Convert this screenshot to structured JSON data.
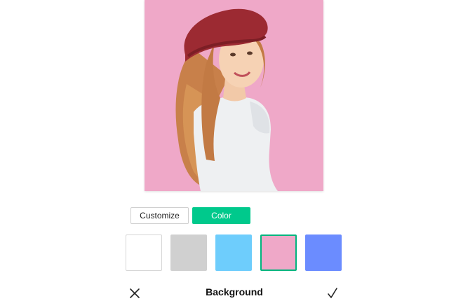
{
  "preview": {
    "background_color": "#efa8c8",
    "subject": "woman-in-red-beret-photo"
  },
  "mode_toggle": {
    "customize_label": "Customize",
    "color_label": "Color",
    "active": "Color",
    "accent_color": "#00c98c"
  },
  "swatches": [
    {
      "color": "#ffffff",
      "selected": false
    },
    {
      "color": "#d0d0d0",
      "selected": false
    },
    {
      "color": "#6ecdfc",
      "selected": false
    },
    {
      "color": "#efa8c8",
      "selected": true
    },
    {
      "color": "#6b8cff",
      "selected": false
    }
  ],
  "bottom_bar": {
    "title": "Background",
    "close_icon": "close-icon",
    "confirm_icon": "checkmark-icon"
  }
}
